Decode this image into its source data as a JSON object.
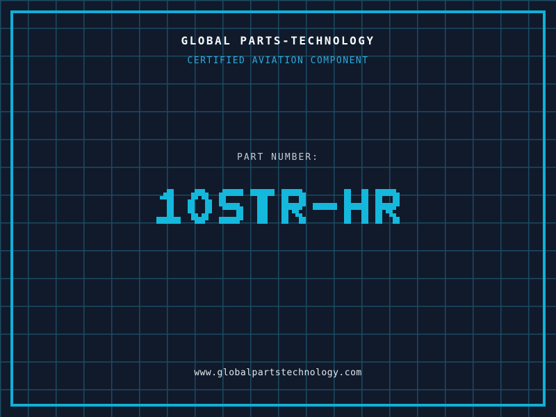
{
  "header": {
    "title": "GLOBAL PARTS-TECHNOLOGY",
    "subtitle": "CERTIFIED AVIATION COMPONENT"
  },
  "part_number": {
    "label": "PART NUMBER:",
    "value": "10STR-HR"
  },
  "footer": {
    "website": "www.globalpartstechnology.com"
  },
  "colors": {
    "background": "#101a2b",
    "grid_line": "#1d4a63",
    "frame_border": "#10b0d6",
    "part_number_cyan": "#14b8dc",
    "subtitle_cyan": "#2aabdd",
    "title_white": "#f5f8fa",
    "label_gray": "#c5ccd6",
    "footer_white": "#e2e8ee"
  }
}
